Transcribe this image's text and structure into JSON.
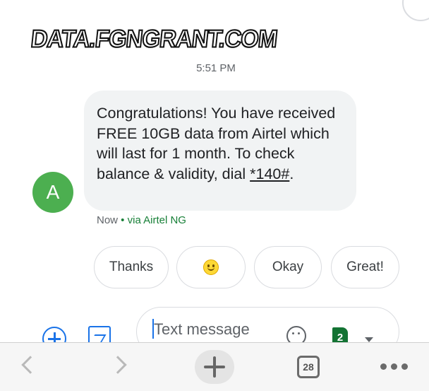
{
  "watermark": {
    "text": "DATA.FGNGRANT.COM"
  },
  "conversation": {
    "timestamp": "5:51 PM",
    "avatar_initial": "A",
    "message": {
      "text_before_code": "Congratulations! You have received FREE 10GB data from Airtel which will last for 1 month. To check balance & validity, dial ",
      "code": "*140#",
      "text_after_code": "."
    },
    "meta": {
      "time": "Now",
      "separator": " • ",
      "via": "via Airtel NG"
    }
  },
  "smart_replies": [
    {
      "label": "Thanks"
    },
    {
      "label": "",
      "icon": "smiling-face-emoji-icon"
    },
    {
      "label": "Okay"
    },
    {
      "label": "Great!"
    }
  ],
  "composer": {
    "placeholder": "Text message",
    "sim_slot": "2",
    "icons": [
      "add-attachment-icon",
      "gallery-icon",
      "emoji-icon",
      "sim-card-icon",
      "dropdown-icon"
    ]
  },
  "browser_bar": {
    "tabs_count": "28",
    "icons": [
      "back-icon",
      "forward-icon",
      "new-tab-icon",
      "tabs-icon",
      "more-menu-icon"
    ]
  },
  "colors": {
    "avatar": "#4caf50",
    "bubble": "#f1f3f4",
    "link_green": "#188038",
    "accent_blue": "#1a73e8",
    "sim_green": "#137333"
  }
}
